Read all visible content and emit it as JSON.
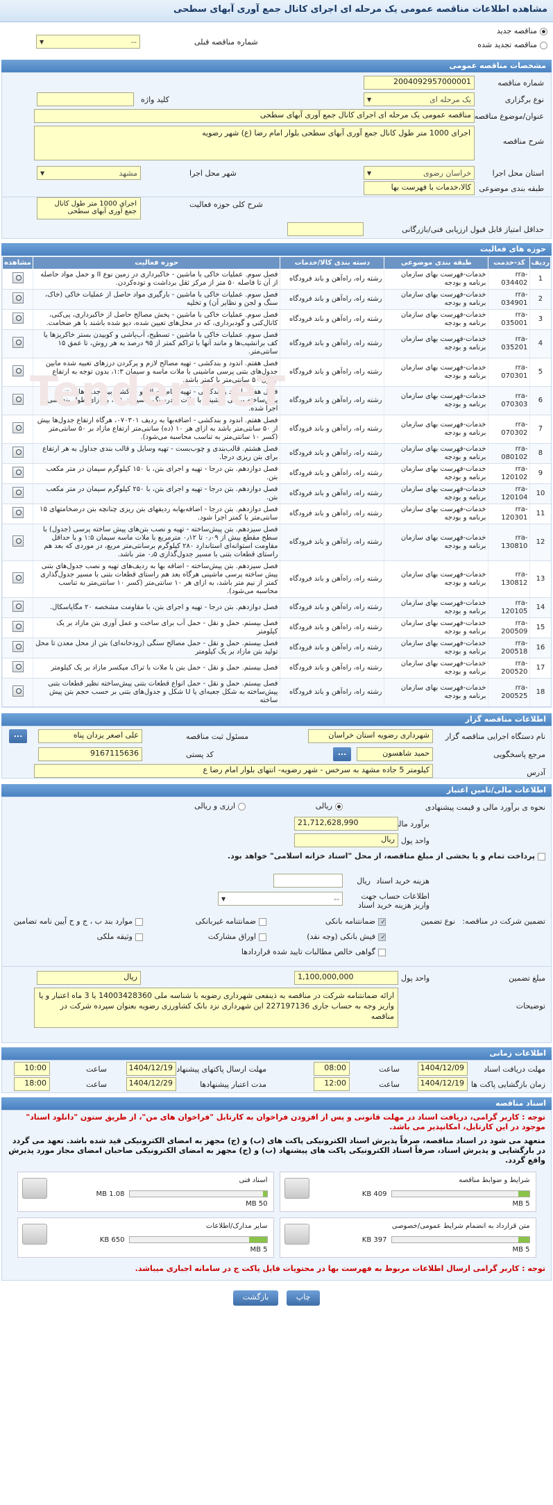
{
  "title": "مشاهده اطلاعات مناقصه عمومی یک مرحله ای اجرای کانال جمع آوری آبهای سطحی",
  "status_new": "مناقصه جدید",
  "status_renewed": "مناقصه تجدید شده",
  "prev_tender_label": "شماره مناقصه قبلی",
  "prev_tender_value": "--",
  "general": {
    "header": "مشخصات مناقصه عمومی",
    "number_label": "شماره مناقصه",
    "number": "2004092957000001",
    "type_label": "نوع برگزاری",
    "type": "یک مرحله ای",
    "keyword_label": "کلید واژه",
    "subject_label": "عنوان/موضوع مناقصه",
    "subject": "مناقصه عمومی یک مرحله ای اجرای کانال جمع آوری آبهای سطحی",
    "desc_label": "شرح مناقصه",
    "desc": "اجرای 1000 متر طول کانال جمع آوری آبهای سطحی بلوار امام رضا (ع) شهر رضویه",
    "province_label": "استان محل اجرا",
    "province": "خراسان رضوی",
    "city_label": "شهر محل اجرا",
    "city": "مشهد",
    "category_label": "طبقه بندی موضوعی",
    "category": "کالا،خدمات با فهرست بها",
    "scope_label": "شرح کلی حوزه فعالیت",
    "scope": "اجرای 1000 متر طول کانال جمع آوری آبهای سطحی",
    "min_score_label": "حداقل امتیاز قابل قبول ارزیابی فنی/بازرگانی"
  },
  "activities": {
    "header": "حوزه های فعالیت",
    "columns": [
      "ردیف",
      "کد-خدمت",
      "طبقه بندی موضوعی",
      "دسته بندی کالا/خدمات",
      "حوزه فعالیت",
      "مشاهده"
    ],
    "rows": [
      [
        "1",
        "rra-034402",
        "خدمات-فهرست بهای سازمان برنامه و بودجه",
        "رشته راه، راه‌آهن و باند فرودگاه",
        "فصل سوم. عملیات خاکی با ماشین - خاکبرداری در زمین نوع II و حمل مواد حاصله از آن تا فاصله ۵۰ متر از مرکز ثقل برداشت و توده‌کردن."
      ],
      [
        "2",
        "rra-034901",
        "خدمات-فهرست بهای سازمان برنامه و بودجه",
        "رشته راه، راه‌آهن و باند فرودگاه",
        "فصل سوم. عملیات خاکی با ماشین - بارگیری مواد حاصل از عملیات خاکی (خاک، سنگ و لجن و نظایر آن) و تخلیه"
      ],
      [
        "3",
        "rra-035001",
        "خدمات-فهرست بهای سازمان برنامه و بودجه",
        "رشته راه، راه‌آهن و باند فرودگاه",
        "فصل سوم. عملیات خاکی با ماشین - پخش مصالح حاصل از خاکبرداری، پی‌کنی، کانال‌کنی و گودبرداری، که در محل‌های تعیین شده، دپو شده باشند با هر ضخامت."
      ],
      [
        "4",
        "rra-035201",
        "خدمات-فهرست بهای سازمان برنامه و بودجه",
        "رشته راه، راه‌آهن و باند فرودگاه",
        "فصل سوم. عملیات خاکی با ماشین - تسطیح، آب‌پاشی و کوبیدن بستر خاکریزها یا کف برانشیب‌ها و مانند آنها با تراکم کمتر از ۹۵ درصد به هر روش، تا عمق ۱۵ سانتی‌متر."
      ],
      [
        "5",
        "rra-070301",
        "خدمات-فهرست بهای سازمان برنامه و بودجه",
        "رشته راه، راه‌آهن و باند فرودگاه",
        "فصل هفتم. اندود و بندکشی - تهیه مصالح لازم و پرکردن درزهای تعبیه شده مابین جدول‌های بتنی پرسی ماشینی با ملات ماسه و سیمان ۱:۳، بدون توجه به ارتفاع جدول ۵۰ سانتی‌متر یا کمتر باشد."
      ],
      [
        "6",
        "rra-070303",
        "خدمات-فهرست بهای سازمان برنامه و بودجه",
        "رشته راه، راه‌آهن و باند فرودگاه",
        "فصل هفتم. اندود و بندکشی - تهیه تمام مصالح و بندکشی بین جدول‌های بتنی پیش‌ساخته پرسی ماشینی با ملات پودرسنگ و سیمان ۲:۱، به ازای طول بندکشی اجرا شده."
      ],
      [
        "7",
        "rra-070302",
        "خدمات-فهرست بهای سازمان برنامه و بودجه",
        "رشته راه، راه‌آهن و باند فرودگاه",
        "فصل هفتم. اندود و بندکشی - اضافه‌بها به ردیف ۰۷۰۳۰۱، هرگاه ارتفاع جدول‌ها بیش از ۵۰ سانتی‌متر باشد به ازای هر ۱۰ (ده) سانتی‌متر ارتفاع مازاد بر ۵۰ سانتی‌متر (کسر ۱۰ سانتی‌متر به تناسب محاسبه می‌شود)."
      ],
      [
        "8",
        "rra-080102",
        "خدمات-فهرست بهای سازمان برنامه و بودجه",
        "رشته راه، راه‌آهن و باند فرودگاه",
        "فصل هشتم. قالب‌بندی و چوب‌بست - تهیه وسایل و قالب بندی جداول به هر ارتفاع برای بتن ریزی درجا."
      ],
      [
        "9",
        "rra-120102",
        "خدمات-فهرست بهای سازمان برنامه و بودجه",
        "رشته راه، راه‌آهن و باند فرودگاه",
        "فصل دوازدهم. بتن درجا - تهیه و اجرای بتن، با ۱۵۰ کیلوگرم سیمان در متر مکعب بتن."
      ],
      [
        "10",
        "rra-120104",
        "خدمات-فهرست بهای سازمان برنامه و بودجه",
        "رشته راه، راه‌آهن و باند فرودگاه",
        "فصل دوازدهم. بتن درجا - تهیه و اجرای بتن، با ۲۵۰ کیلوگرم سیمان در متر مکعب بتن."
      ],
      [
        "11",
        "rra-120301",
        "خدمات-فهرست بهای سازمان برنامه و بودجه",
        "رشته راه، راه‌آهن و باند فرودگاه",
        "فصل دوازدهم. بتن درجا - اضافه‌بهابه ردیفهای بتن ریزی چنانچه بتن درضخامتهای ۱۵ سانتی‌متر یا کمتر اجرا شود."
      ],
      [
        "12",
        "rra-130810",
        "خدمات-فهرست بهای سازمان برنامه و بودجه",
        "رشته راه، راه‌آهن و باند فرودگاه",
        "فصل سیزدهم. بتن پیش‌ساخته - تهیه و نصب بتن‌های پیش ساخته پرسی (جدول) با سطح مقطع بیش از ۰٫۰۹ تا ۰٫۱۲ مترمربع با ملات ماسه سیمان ۱:۵ و با حداقل مقاومت استوانه‌ای استاندارد ۲۸۰ کیلوگرم برسانتی‌متر مربع، در موردی که بعد هم راستای قطعات بتنی با مسیر جدول‌گذاری ۰٫۵ متر باشد."
      ],
      [
        "13",
        "rra-130812",
        "خدمات-فهرست بهای سازمان برنامه و بودجه",
        "رشته راه، راه‌آهن و باند فرودگاه",
        "فصل سیزدهم. بتن پیش‌ساخته - اضافه بها به ردیف‌های تهیه و نصب جدول‌های بتنی پیش ساخته پرسی ماشینی هرگاه بعد هم راستای قطعات بتنی با مسیر جدول‌گذاری کمتر از نیم متر باشد، به ازای هر ۱۰ سانتی‌متر (کسر ۱۰ سانتی‌متر به تناسب محاسبه می‌شود)."
      ],
      [
        "14",
        "rra-120105",
        "خدمات-فهرست بهای سازمان برنامه و بودجه",
        "رشته راه، راه‌آهن و باند فرودگاه",
        "فصل دوازدهم. بتن درجا - تهیه و اجرای بتن، با مقاومت مشخصه ۲۰ مگاپاسکال."
      ],
      [
        "15",
        "rra-200509",
        "خدمات-فهرست بهای سازمان برنامه و بودجه",
        "رشته راه، راه‌آهن و باند فرودگاه",
        "فصل بیستم. حمل و نقل - حمل آب برای ساخت و عمل آوری بتن مازاد بر یک کیلومتر"
      ],
      [
        "16",
        "rra-200518",
        "خدمات-فهرست بهای سازمان برنامه و بودجه",
        "رشته راه، راه‌آهن و باند فرودگاه",
        "فصل بیستم. حمل و نقل - حمل مصالح سنگی (رودخانه‌ای) بتن از محل معدن تا محل تولید بتن مازاد بر یک کیلومتر"
      ],
      [
        "17",
        "rra-200520",
        "خدمات-فهرست بهای سازمان برنامه و بودجه",
        "رشته راه، راه‌آهن و باند فرودگاه",
        "فصل بیستم. حمل و نقل - حمل بتن با ملات با تراک میکسر مازاد بر یک کیلومتر"
      ],
      [
        "18",
        "rra-200525",
        "خدمات-فهرست بهای سازمان برنامه و بودجه",
        "رشته راه، راه‌آهن و باند فرودگاه",
        "فصل بیستم. حمل و نقل - حمل انواع قطعات بتنی پیش‌ساخته نظیر قطعات بتنی پیش‌ساخته به شکل جعبه‌ای یا U شکل و جدول‌های بتنی بر حسب حجم بتن پیش ساخته"
      ]
    ]
  },
  "organizer": {
    "header": "اطلاعات مناقصه گزار",
    "org_label": "نام دستگاه اجرایی مناقصه گزار",
    "org": "شهرداری رضویه استان خراسان",
    "resp_label": "مسئول ثبت مناقصه",
    "resp": "علی اصغر یزدان پناه",
    "ref_label": "مرجع پاسخگویی",
    "ref": "حمید شاهسون",
    "postal_label": "کد پستی",
    "postal": "9167115636",
    "addr_label": "آدرس",
    "addr": "کیلومتر 5 جاده مشهد به سرخس - شهر رضویه- انتهای بلوار امام رضا ع"
  },
  "finance": {
    "header": "اطلاعات مالی/تامین اعتبار",
    "method_label": "نحوه ی برآورد مالی و قیمت پیشنهادی",
    "method_rial": "ریالی",
    "method_mixed": "ارزی و ریالی",
    "estimate_label": "برآورد مالی",
    "estimate": "21,712,628,990",
    "currency_label": "واحد پول",
    "currency": "ریال",
    "note": "پرداخت تمام و یا بخشی از مبلغ مناقصه، از محل \"اسناد خزانه اسلامی\" خواهد بود.",
    "doc_fee_label": "هزینه خرید اسناد",
    "doc_fee_unit": "ریال",
    "bank_label": "اطلاعات حساب جهت واریز هزینه خرید اسناد",
    "bank_value": "--",
    "guarantee_label": "تضمین شرکت در مناقصه:",
    "guarantee_type_label": "نوع تضمین",
    "opt1": "ضمانتنامه بانکی",
    "opt2": "ضمانتنامه غیربانکی",
    "opt3": "موارد بند ب ، ج و ح آیین نامه تضامین",
    "opt4": "فیش بانکی (وجه نقد)",
    "opt5": "اوراق مشارکت",
    "opt6": "وثیقه ملکی",
    "opt7": "گواهی خالص مطالبات تایید شده قراردادها",
    "amount_label": "مبلغ تضمین",
    "amount": "1,100,000,000",
    "amount_unit_label": "واحد پول",
    "amount_unit": "ریال",
    "desc_label": "توضیحات",
    "desc": "ارائه ضمانتنامه شرکت در مناقصه به ذینفعی شهرداری رضویه با شناسه ملی 14003428360 یا 3 ماه اعتبار و یا واریز وجه به حساب جاری 227197136 این شهرداری نزد بانک کشاورزی رضویه بعنوان سپرده شرکت در مناقصه"
  },
  "timing": {
    "header": "اطلاعات زمانی",
    "recv_label": "مهلت دریافت اسناد",
    "recv_date": "1404/12/09",
    "recv_time": "08:00",
    "send_label": "مهلت ارسال پاکتهای پیشنهاد",
    "send_date": "1404/12/19",
    "send_time": "10:00",
    "open_label": "زمان بازگشایی پاکت ها",
    "open_date": "1404/12/19",
    "open_time": "12:00",
    "valid_label": "مدت اعتبار پیشنهادها",
    "valid_date": "1404/12/29",
    "valid_time": "18:00",
    "time_label": "ساعت"
  },
  "docs": {
    "header": "اسناد مناقصه",
    "note1": "توجه : کاربر گرامی، دریافت اسناد در مهلت قانونی و پس از افزودن فراخوان به کارتابل \"فراخوان های من\"، از طریق ستون \"دانلود اسناد\" موجود در این کارتابل، امکانپذیر می باشد.",
    "note2": "متعهد می شود در اسناد مناقصه، صرفاً پذیرش اسناد الکترونیکی پاکت های (ب) و (ج) مجهز به امضای الکترونیکی قید شده باشد. تعهد می گردد در بارگشایی و پذیرش اسناد، صرفاً اسناد الکترونیکی پاکت های پیشنهاد (ب) و (ج) مجهز به امضای الکترونیکی صاحبان امضای مجاز مورد پذیرش واقع گردد.",
    "items": [
      {
        "title": "شرایط و ضوابط مناقصه",
        "used": "409 KB",
        "max": "5 MB",
        "fill": 0.08
      },
      {
        "title": "اسناد فنی",
        "used": "1.08 MB",
        "max": "50 MB",
        "fill": 0.03
      },
      {
        "title": "متن قرارداد به انضمام شرایط عمومی/خصوصی",
        "used": "397 KB",
        "max": "5 MB",
        "fill": 0.08
      },
      {
        "title": "سایر مدارک/اطلاعات",
        "used": "650 KB",
        "max": "5 MB",
        "fill": 0.13
      }
    ],
    "note3": "توجه : کاربر گرامی ارسال اطلاعات مربوط به فهرست بها در محتویات فایل پاکت ج در سامانه اجباری میباشد."
  },
  "buttons": {
    "back": "بازگشت",
    "print": "چاپ"
  },
  "watermark": "Tender.neT"
}
